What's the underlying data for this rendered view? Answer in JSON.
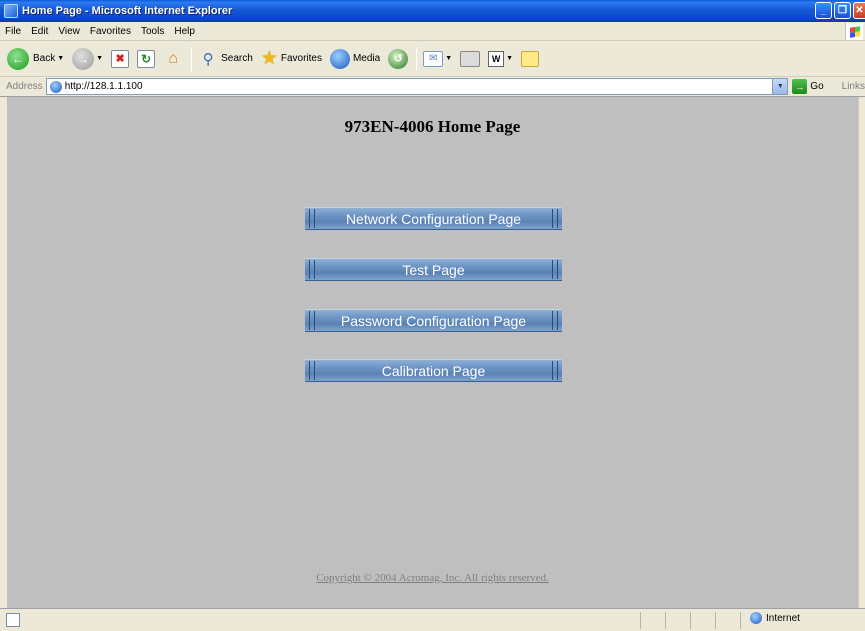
{
  "window": {
    "title": "Home Page - Microsoft Internet Explorer"
  },
  "menu": {
    "items": [
      "File",
      "Edit",
      "View",
      "Favorites",
      "Tools",
      "Help"
    ]
  },
  "toolbar": {
    "back_label": "Back",
    "search_label": "Search",
    "favorites_label": "Favorites",
    "media_label": "Media"
  },
  "address": {
    "label": "Address",
    "url": "http://128.1.1.100",
    "go_label": "Go",
    "links_label": "Links"
  },
  "page": {
    "title": "973EN-4006 Home Page",
    "buttons": [
      "Network Configuration Page",
      "Test Page",
      "Password Configuration Page",
      "Calibration Page"
    ],
    "copyright": "Copyright © 2004 Acromag, Inc. All rights reserved."
  },
  "status": {
    "zone": "Internet"
  }
}
